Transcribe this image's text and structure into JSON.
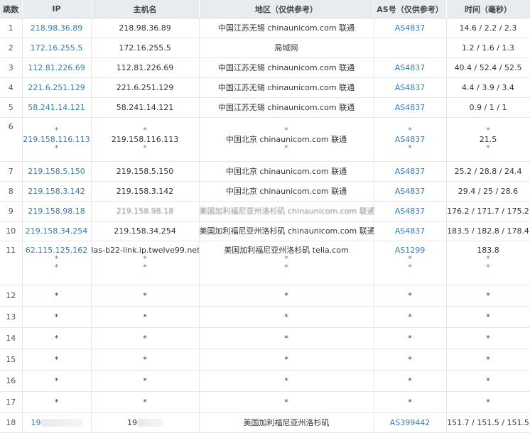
{
  "headers": {
    "hop": "跳数",
    "ip": "IP",
    "host": "主机名",
    "region": "地区（仅供参考）",
    "as": "AS号（仅供参考）",
    "time": "时间（毫秒）"
  },
  "star": "*",
  "rows": [
    {
      "hop": "1",
      "ip": "218.98.36.89",
      "host": "218.98.36.89",
      "region": "中国江苏无锡 chinaunicom.com 联通",
      "as": "AS4837",
      "time": "14.6 / 2.2 / 2.3"
    },
    {
      "hop": "2",
      "ip": "172.16.255.5",
      "host": "172.16.255.5",
      "region": "局域网",
      "as": "",
      "time": "1.2 / 1.6 / 1.3"
    },
    {
      "hop": "3",
      "ip": "112.81.226.69",
      "host": "112.81.226.69",
      "region": "中国江苏无锡 chinaunicom.com 联通",
      "as": "AS4837",
      "time": "40.4 / 52.4 / 52.5"
    },
    {
      "hop": "4",
      "ip": "221.6.251.129",
      "host": "221.6.251.129",
      "region": "中国江苏无锡 chinaunicom.com 联通",
      "as": "AS4837",
      "time": "4.4 / 3.9 / 3.4"
    },
    {
      "hop": "5",
      "ip": "58.241.14.121",
      "host": "58.241.14.121",
      "region": "中国江苏无锡 chinaunicom.com 联通",
      "as": "AS4837",
      "time": "0.9 / 1 / 1"
    },
    {
      "hop": "6",
      "ip": "219.158.116.113",
      "host": "219.158.116.113",
      "region": "中国北京 chinaunicom.com 联通",
      "as": "AS4837",
      "time": "21.5"
    },
    {
      "hop": "7",
      "ip": "219.158.5.150",
      "host": "219.158.5.150",
      "region": "中国北京 chinaunicom.com 联通",
      "as": "AS4837",
      "time": "25.2 / 28.8 / 24.4"
    },
    {
      "hop": "8",
      "ip": "219.158.3.142",
      "host": "219.158.3.142",
      "region": "中国北京 chinaunicom.com 联通",
      "as": "AS4837",
      "time": "29.4 / 25 / 28.6"
    },
    {
      "hop": "9",
      "ip": "219.158.98.18",
      "host": "219.158.98.18",
      "region": "美国加利福尼亚州洛杉矶 chinaunicom.com 联通",
      "as": "AS4837",
      "time": "176.2 / 171.7 / 175.2"
    },
    {
      "hop": "10",
      "ip": "219.158.34.254",
      "host": "219.158.34.254",
      "region": "美国加利福尼亚州洛杉矶 chinaunicom.com 联通",
      "as": "AS4837",
      "time": "183.5 / 182.8 / 178.4"
    },
    {
      "hop": "11",
      "ip": "62.115.125.162",
      "host": "las-b22-link.ip.twelve99.net",
      "region": "美国加利福尼亚州洛杉矶 telia.com",
      "as": "AS1299",
      "time": "183.8"
    },
    {
      "hop": "12"
    },
    {
      "hop": "13"
    },
    {
      "hop": "14"
    },
    {
      "hop": "15"
    },
    {
      "hop": "16"
    },
    {
      "hop": "17"
    },
    {
      "hop": "18",
      "ip": "19",
      "host": "19",
      "region": "美国加利福尼亚州洛杉矶",
      "as": "AS399442",
      "time": "151.7 / 151.5 / 151.5"
    }
  ]
}
